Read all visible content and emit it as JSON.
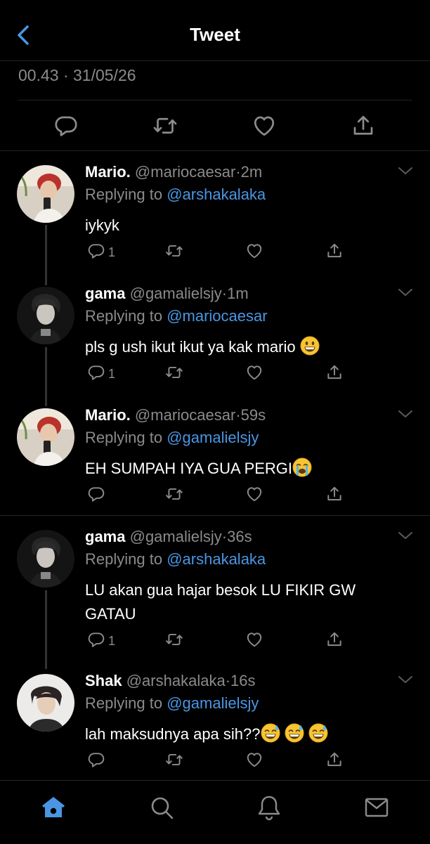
{
  "header": {
    "title": "Tweet"
  },
  "tweet": {
    "timestamp": "00.43 · 31/05/26"
  },
  "replies": [
    {
      "name": "Mario.",
      "handle": "@mariocaesar",
      "dot": "·",
      "time": "2m",
      "replying_label": "Replying to",
      "replying_to": "@arshakalaka",
      "text": "iykyk",
      "reply_count": "1"
    },
    {
      "name": "gama",
      "handle": "@gamalielsjy",
      "dot": "·",
      "time": "1m",
      "replying_label": "Replying to",
      "replying_to": "@mariocaesar",
      "text": "pls g ush ikut ikut ya kak mario",
      "reply_count": "1"
    },
    {
      "name": "Mario.",
      "handle": "@mariocaesar",
      "dot": "·",
      "time": "59s",
      "replying_label": "Replying to",
      "replying_to": "@gamalielsjy",
      "text": "EH SUMPAH IYA GUA PERGI",
      "reply_count": ""
    },
    {
      "name": "gama",
      "handle": "@gamalielsjy",
      "dot": "·",
      "time": "36s",
      "replying_label": "Replying to",
      "replying_to": "@arshakalaka",
      "text": "LU akan gua hajar besok LU FIKIR GW GATAU",
      "reply_count": "1"
    },
    {
      "name": "Shak",
      "handle": "@arshakalaka",
      "dot": "·",
      "time": "16s",
      "replying_label": "Replying to",
      "replying_to": "@gamalielsjy",
      "text": "lah maksudnya apa sih??",
      "reply_count": ""
    }
  ],
  "icons": {
    "back": "chevron-left-icon",
    "reply": "comment-icon",
    "retweet": "retweet-icon",
    "like": "heart-icon",
    "share": "share-icon",
    "more": "chevron-down-icon",
    "home": "home-icon",
    "search": "search-icon",
    "notifications": "bell-icon",
    "messages": "mail-icon"
  },
  "colors": {
    "accent": "#4a96e3",
    "muted": "#8b8b8b",
    "background": "#000000"
  }
}
